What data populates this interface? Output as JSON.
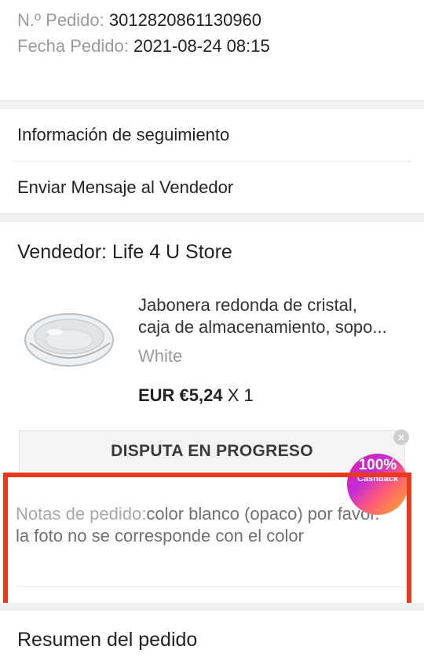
{
  "order": {
    "number_label": "N.º Pedido:",
    "number_value": "3012820861130960",
    "date_label": "Fecha Pedido:",
    "date_value": "2021-08-24 08:15"
  },
  "menu": {
    "tracking_label": "Información de seguimiento",
    "message_label": "Enviar Mensaje al Vendedor"
  },
  "seller": {
    "name": "Vendedor: Life 4 U Store"
  },
  "product": {
    "title_line1": "Jabonera redonda de cristal,",
    "title_line2": "caja de almacenamiento, sopo...",
    "variant": "White",
    "price": "EUR €5,24",
    "quantity": "X 1"
  },
  "dispute": {
    "label": "DISPUTA EN PROGRESO",
    "close_glyph": "×"
  },
  "notes": {
    "label": "Notas de pedido:",
    "text": "color blanco (opaco) por favor. la foto no se corresponde con el color"
  },
  "cashback": {
    "percent": "100%",
    "label": "Cashback"
  },
  "summary": {
    "label": "Resumen del pedido"
  },
  "colors": {
    "highlight": "#e8391f",
    "muted_text": "#9a9a9a"
  },
  "icons": {
    "product_image": "soap-dish-image",
    "close": "close-icon"
  }
}
